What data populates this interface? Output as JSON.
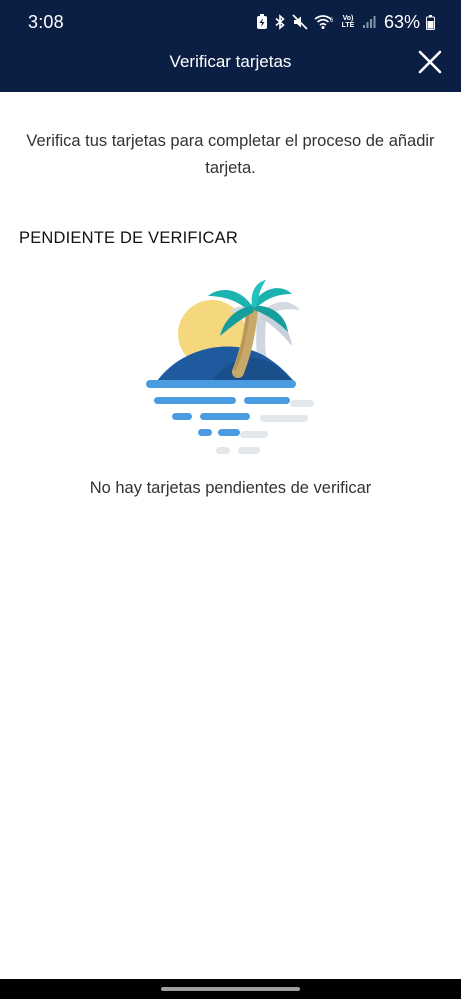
{
  "status_bar": {
    "time": "3:08",
    "network_label": "Vo) LTE",
    "battery_percent": "63%",
    "icons": [
      "battery-saver-icon",
      "bluetooth-icon",
      "mute-icon",
      "wifi-icon",
      "volte-icon",
      "signal-icon",
      "battery-icon"
    ]
  },
  "header": {
    "title": "Verificar tarjetas",
    "close_icon": "close-icon"
  },
  "main": {
    "intro_text": "Verifica tus tarjetas para completar el proceso de añadir tarjeta.",
    "section_heading": "PENDIENTE DE VERIFICAR",
    "illustration": "island-palm-illustration",
    "empty_message": "No hay tarjetas pendientes de verificar"
  },
  "colors": {
    "header_bg": "#0b1f44",
    "text_dark": "#333333",
    "island_blue": "#1f5a9e",
    "water_blue": "#4a9be0",
    "palm_teal": "#1bb3b0",
    "sun_yellow": "#f5d77e"
  }
}
